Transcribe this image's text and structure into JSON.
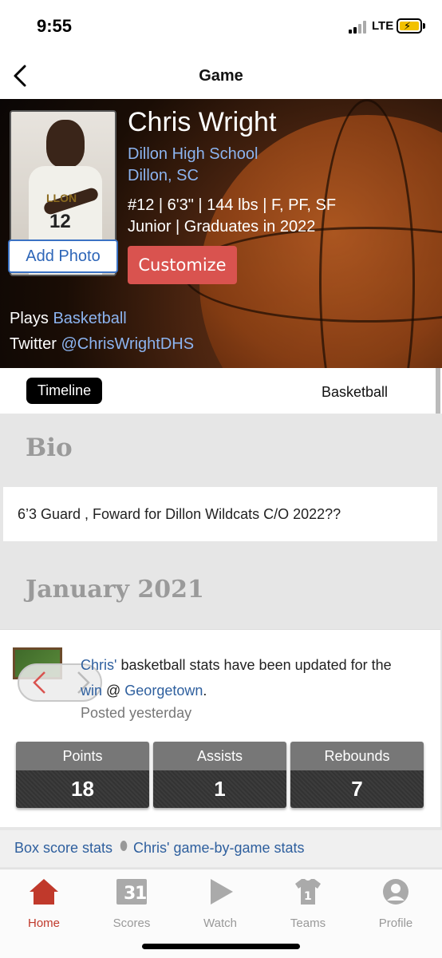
{
  "status_bar": {
    "time": "9:55",
    "network": "LTE"
  },
  "header": {
    "title": "Game"
  },
  "profile": {
    "name": "Chris Wright",
    "school": "Dillon High School",
    "city": "Dillon, SC",
    "details": "#12 | 6'3\" | 144 lbs | F, PF, SF",
    "class_line": "Junior | Graduates in 2022",
    "jersey_text": "LLON",
    "jersey_number": "12",
    "add_photo_label": "Add Photo",
    "customize_label": "Customize",
    "plays_label": "Plays",
    "sport": "Basketball",
    "twitter_label": "Twitter",
    "twitter_handle": "@ChrisWrightDHS"
  },
  "tabs": {
    "timeline": "Timeline",
    "basketball": "Basketball"
  },
  "bio": {
    "heading": "Bio",
    "text": "6’3 Guard , Foward for Dillon Wildcats C/O 2022??"
  },
  "timeline": {
    "month_heading": "January 2021",
    "post": {
      "author_link": "Chris'",
      "text_main": " basketball stats have been updated for the ",
      "win_link": "win",
      "at": " @ ",
      "opponent_link": "Georgetown",
      "period": ".",
      "posted": "Posted yesterday",
      "stats": [
        {
          "label": "Points",
          "value": "18"
        },
        {
          "label": "Assists",
          "value": "1"
        },
        {
          "label": "Rebounds",
          "value": "7"
        }
      ]
    },
    "links": {
      "box_score": "Box score stats",
      "game_by_game": "Chris' game-by-game stats"
    }
  },
  "bottom_nav": {
    "items": [
      {
        "label": "Home",
        "icon": "home-icon"
      },
      {
        "label": "Scores",
        "icon": "scores-icon"
      },
      {
        "label": "Watch",
        "icon": "watch-icon"
      },
      {
        "label": "Teams",
        "icon": "teams-icon"
      },
      {
        "label": "Profile",
        "icon": "profile-icon"
      }
    ]
  },
  "colors": {
    "accent_red": "#d9534f",
    "link_blue": "#2e5f9e",
    "hero_link": "#8cb4f0",
    "active_nav": "#c0392b"
  }
}
